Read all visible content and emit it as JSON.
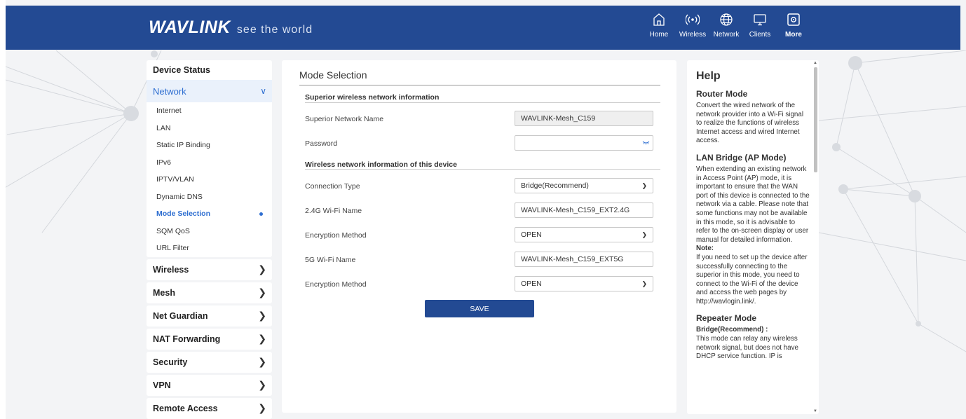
{
  "header": {
    "brand": "WAVLINK",
    "tagline": "see the world",
    "nav": [
      {
        "label": "Home",
        "icon": "home-icon"
      },
      {
        "label": "Wireless",
        "icon": "wireless-icon"
      },
      {
        "label": "Network",
        "icon": "globe-icon"
      },
      {
        "label": "Clients",
        "icon": "monitor-icon"
      },
      {
        "label": "More",
        "icon": "more-icon"
      }
    ]
  },
  "sidebar": {
    "device_status": "Device Status",
    "network_group": {
      "label": "Network",
      "items": [
        "Internet",
        "LAN",
        "Static IP Binding",
        "IPv6",
        "IPTV/VLAN",
        "Dynamic DNS",
        "Mode Selection",
        "SQM QoS",
        "URL Filter"
      ]
    },
    "sections": [
      "Wireless",
      "Mesh",
      "Net Guardian",
      "NAT Forwarding",
      "Security",
      "VPN",
      "Remote Access"
    ]
  },
  "main": {
    "title": "Mode Selection",
    "superior_header": "Superior wireless network information",
    "superior_network_name_label": "Superior Network Name",
    "superior_network_name_value": "WAVLINK-Mesh_C159",
    "password_label": "Password",
    "password_value": "",
    "device_header": "Wireless network information of this device",
    "connection_type_label": "Connection Type",
    "connection_type_value": "Bridge(Recommend)",
    "wifi24_label": "2.4G Wi-Fi Name",
    "wifi24_value": "WAVLINK-Mesh_C159_EXT2.4G",
    "encryption_label": "Encryption Method",
    "encryption24_value": "OPEN",
    "wifi5_label": "5G Wi-Fi Name",
    "wifi5_value": "WAVLINK-Mesh_C159_EXT5G",
    "encryption5_value": "OPEN",
    "save_label": "SAVE"
  },
  "help": {
    "title": "Help",
    "router_mode_title": "Router Mode",
    "router_mode_text": "Convert the wired network of the network provider into a Wi-Fi signal to realize the functions of wireless Internet access and wired Internet access.",
    "lan_bridge_title": "LAN Bridge (AP Mode)",
    "lan_bridge_text": "When extending an existing network in Access Point (AP) mode, it is important to ensure that the WAN port of this device is connected to the network via a cable. Please note that some functions may not be available in this mode, so it is advisable to refer to the on-screen display or user manual for detailed information.",
    "note_label": "Note:",
    "note_text": "If you need to set up the device after successfully connecting to the superior in this mode, you need to connect to the Wi-Fi of the device and access the web pages by http://wavlogin.link/.",
    "repeater_title": "Repeater Mode",
    "bridge_label": "Bridge(Recommend) :",
    "bridge_text": "This mode can relay any wireless network signal, but does not have DHCP service function. IP is"
  },
  "colors": {
    "header_bg": "#234a93",
    "accent": "#2f6fd1",
    "save_button": "#234a93"
  }
}
